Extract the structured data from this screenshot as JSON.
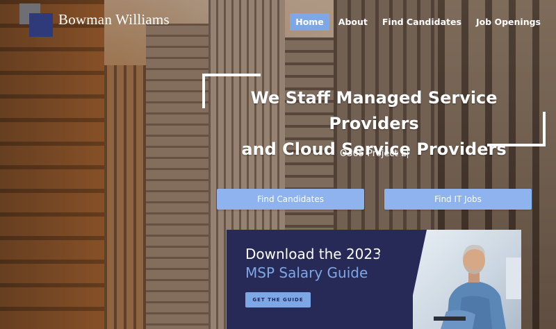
{
  "header": {
    "brand": "Bowman Williams",
    "nav": [
      {
        "label": "Home",
        "active": true
      },
      {
        "label": "About",
        "active": false
      },
      {
        "label": "Find Candidates",
        "active": false
      },
      {
        "label": "Job Openings",
        "active": false
      }
    ]
  },
  "hero": {
    "headline_line1": "We Staff Managed Service Providers",
    "headline_line2": "and Cloud Service Providers",
    "rotating_text": "O365 Project E",
    "buttons": {
      "find_candidates": "Find Candidates",
      "find_it_jobs": "Find IT Jobs"
    }
  },
  "promo": {
    "title": "Download the 2023",
    "subtitle": "MSP Salary Guide",
    "cta": "GET THE GUIDE"
  },
  "colors": {
    "accent": "#7ea7e6",
    "button": "#8fb3ee",
    "promo_bg": "#272a57",
    "logo_gray": "#6e6e74",
    "logo_navy": "#2e3a7a"
  }
}
